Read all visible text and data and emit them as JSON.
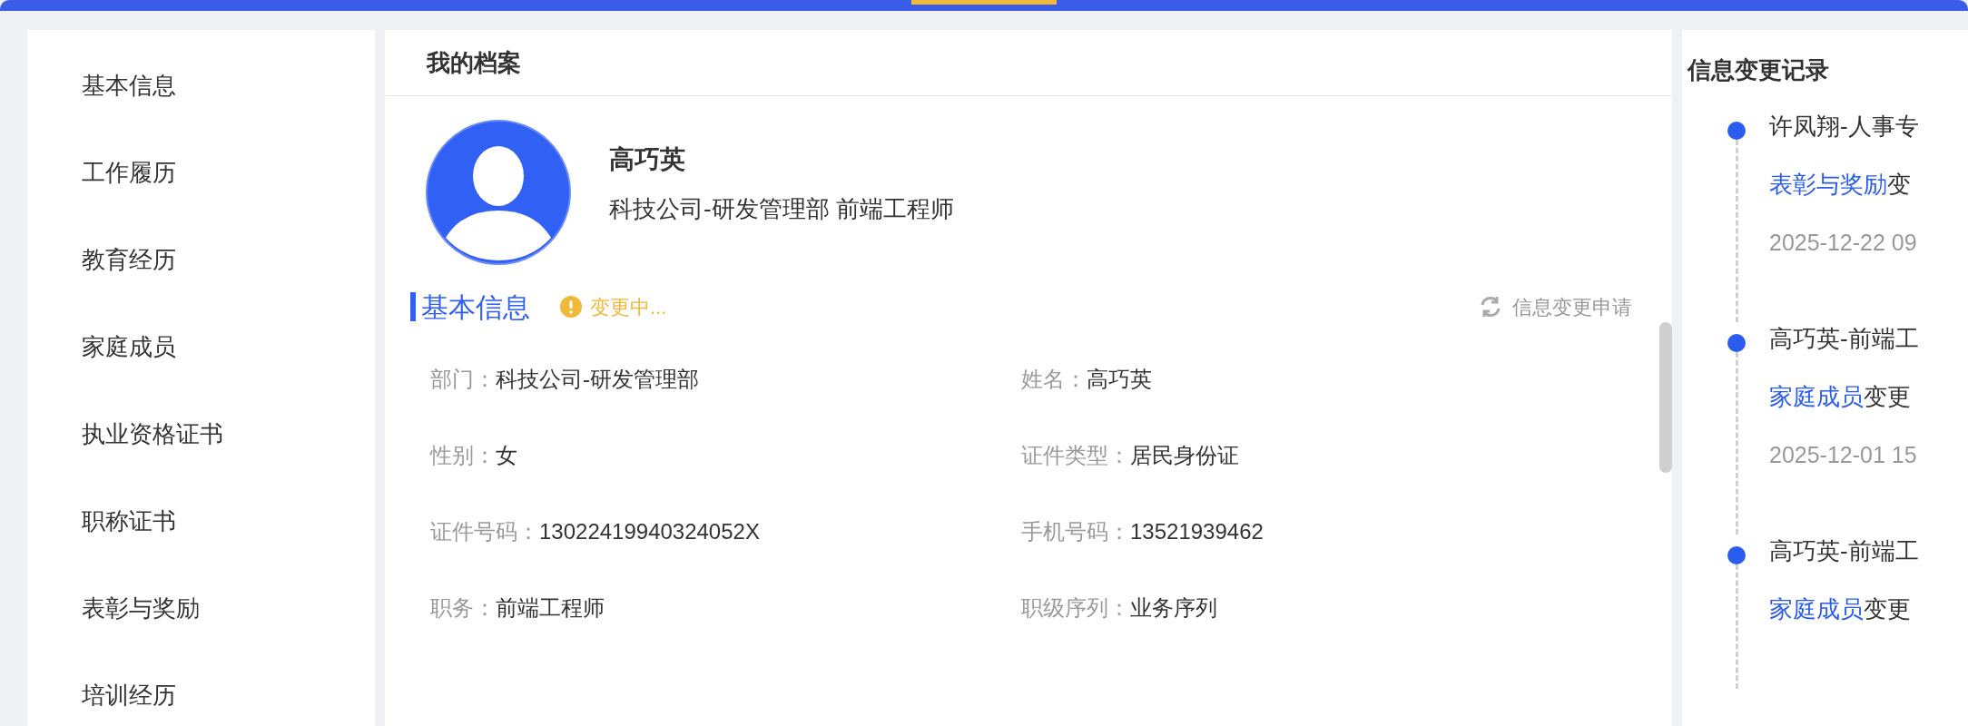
{
  "sidebar": {
    "items": [
      {
        "label": "基本信息"
      },
      {
        "label": "工作履历"
      },
      {
        "label": "教育经历"
      },
      {
        "label": "家庭成员"
      },
      {
        "label": "执业资格证书"
      },
      {
        "label": "职称证书"
      },
      {
        "label": "表彰与奖励"
      },
      {
        "label": "培训经历"
      }
    ]
  },
  "profile": {
    "title": "我的档案",
    "name": "高巧英",
    "subtitle": "科技公司-研发管理部 前端工程师",
    "section": {
      "title": "基本信息",
      "status": "变更中...",
      "action": "信息变更申请"
    },
    "fields": [
      {
        "label": "部门：",
        "value": "科技公司-研发管理部"
      },
      {
        "label": "姓名：",
        "value": "高巧英"
      },
      {
        "label": "性别：",
        "value": "女"
      },
      {
        "label": "证件类型：",
        "value": "居民身份证"
      },
      {
        "label": "证件号码：",
        "value": "13022419940324052X"
      },
      {
        "label": "手机号码：",
        "value": "13521939462"
      },
      {
        "label": "职务：",
        "value": "前端工程师"
      },
      {
        "label": "职级序列：",
        "value": "业务序列"
      }
    ]
  },
  "change_log": {
    "title": "信息变更记录",
    "entries": [
      {
        "author": "许凤翔-人事专",
        "link": "表彰与奖励",
        "action": "变",
        "time": "2025-12-22 09"
      },
      {
        "author": "高巧英-前端工",
        "link": "家庭成员",
        "action": "变更",
        "time": "2025-12-01 15"
      },
      {
        "author": "高巧英-前端工",
        "link": "家庭成员",
        "action": "变更"
      }
    ]
  }
}
